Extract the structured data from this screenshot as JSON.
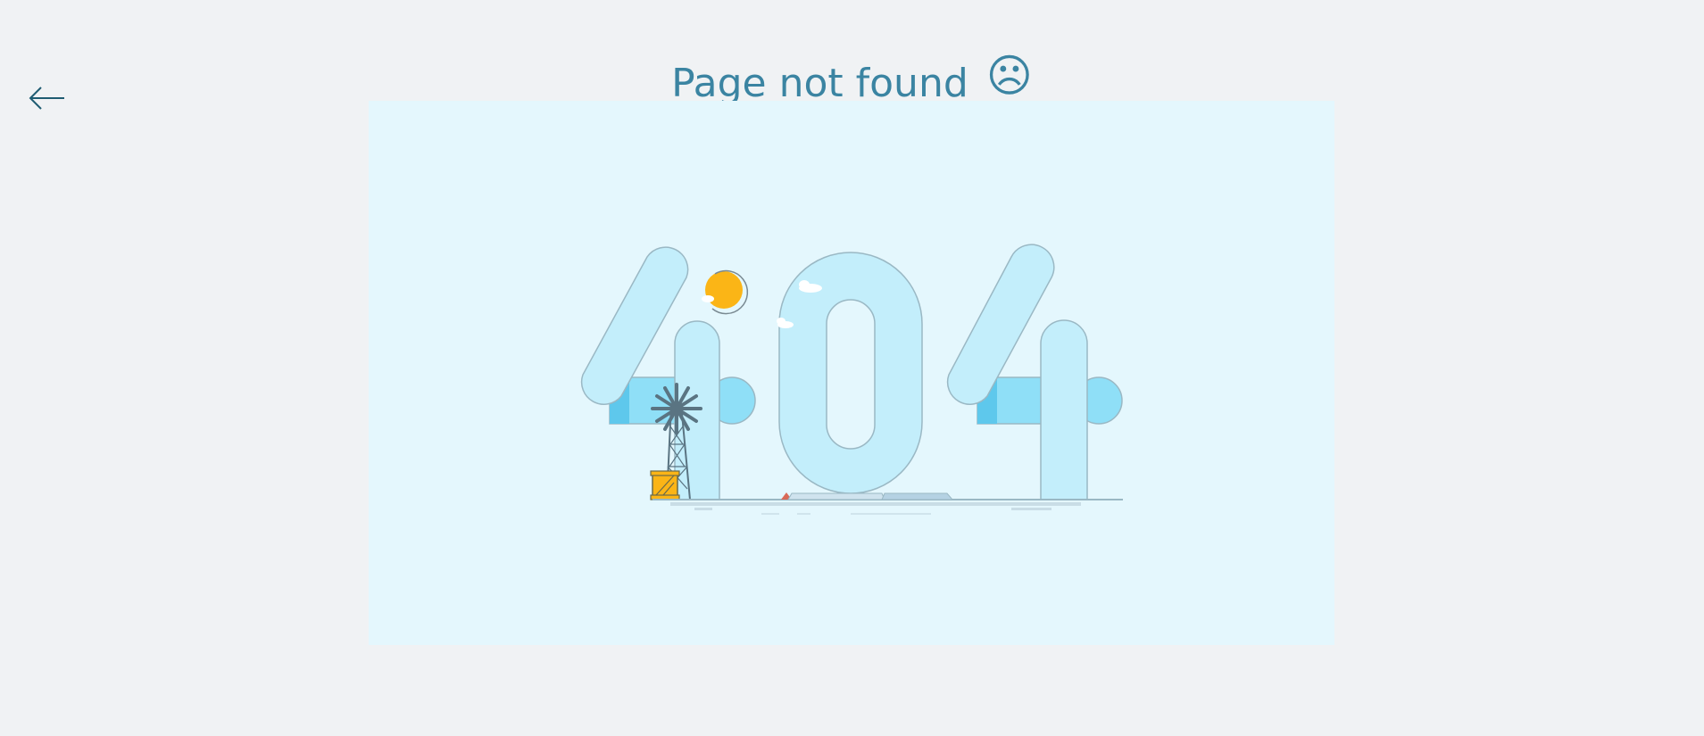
{
  "header": {
    "title": "Page not found",
    "sad_face": "☹",
    "back_icon": "arrow-left-icon"
  },
  "illustration": {
    "icon": "404-illustration",
    "text": "404"
  },
  "colors": {
    "page_background": "#f0f2f4",
    "illustration_background": "#e4f7fd",
    "title_color": "#3b84a2",
    "digit_fill": "#c3eefb",
    "digit_bar_fill": "#8fdff7",
    "sun_color": "#fbb516",
    "back_arrow_color": "#1f5c72"
  }
}
